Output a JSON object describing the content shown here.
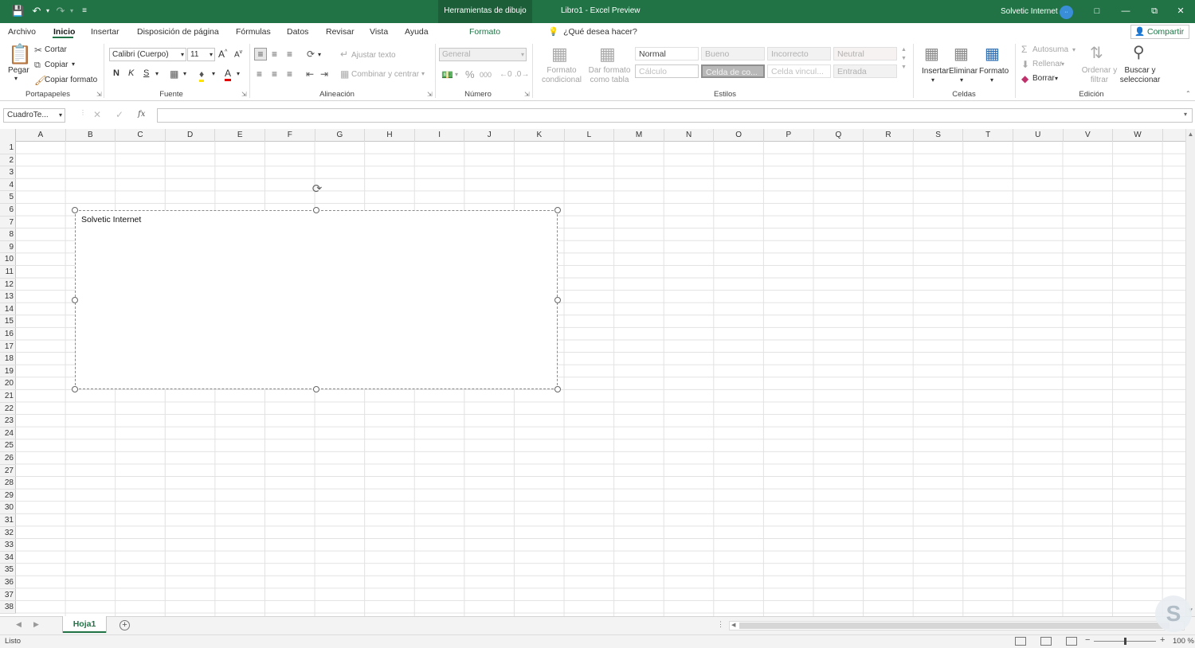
{
  "titlebar": {
    "context_tab": "Herramientas de dibujo",
    "title": "Libro1  -  Excel Preview",
    "user": "Solvetic Internet",
    "avatar_initials": "··"
  },
  "tabs": [
    {
      "label": "Archivo"
    },
    {
      "label": "Inicio"
    },
    {
      "label": "Insertar"
    },
    {
      "label": "Disposición de página"
    },
    {
      "label": "Fórmulas"
    },
    {
      "label": "Datos"
    },
    {
      "label": "Revisar"
    },
    {
      "label": "Vista"
    },
    {
      "label": "Ayuda"
    },
    {
      "label": "Formato"
    }
  ],
  "tell_me": "¿Qué desea hacer?",
  "share": "Compartir",
  "ribbon": {
    "clipboard": {
      "paste": "Pegar",
      "cut": "Cortar",
      "copy": "Copiar",
      "format_painter": "Copiar formato",
      "group": "Portapapeles"
    },
    "font": {
      "name": "Calibri (Cuerpo)",
      "size": "11",
      "bold": "N",
      "italic": "K",
      "underline": "S",
      "group": "Fuente"
    },
    "alignment": {
      "wrap": "Ajustar texto",
      "merge": "Combinar y centrar",
      "group": "Alineación"
    },
    "number": {
      "format": "General",
      "percent": "%",
      "thousands": "000",
      "group": "Número"
    },
    "styles": {
      "conditional": "Formato condicional",
      "as_table": "Dar formato como tabla",
      "cells": [
        "Normal",
        "Bueno",
        "Incorrecto",
        "Neutral",
        "Cálculo",
        "Celda de co...",
        "Celda vincul...",
        "Entrada"
      ],
      "group": "Estilos"
    },
    "cells": {
      "insert": "Insertar",
      "delete": "Eliminar",
      "format": "Formato",
      "group": "Celdas"
    },
    "editing": {
      "autosum": "Autosuma",
      "fill": "Rellenar",
      "clear": "Borrar",
      "sort": "Ordenar y filtrar",
      "find": "Buscar y seleccionar",
      "group": "Edición"
    }
  },
  "formula_bar": {
    "name_box": "CuadroTe...",
    "fx": "fx",
    "value": ""
  },
  "columns": [
    "A",
    "B",
    "C",
    "D",
    "E",
    "F",
    "G",
    "H",
    "I",
    "J",
    "K",
    "L",
    "M",
    "N",
    "O",
    "P",
    "Q",
    "R",
    "S",
    "T",
    "U",
    "V",
    "W"
  ],
  "rows": [
    "1",
    "2",
    "3",
    "4",
    "5",
    "6",
    "7",
    "8",
    "9",
    "10",
    "11",
    "12",
    "13",
    "14",
    "15",
    "16",
    "17",
    "18",
    "19",
    "20",
    "21",
    "22",
    "23",
    "24",
    "25",
    "26",
    "27",
    "28",
    "29",
    "30",
    "31",
    "32",
    "33",
    "34",
    "35",
    "36",
    "37",
    "38"
  ],
  "textbox": {
    "text": "Solvetic Internet"
  },
  "sheets": [
    {
      "name": "Hoja1"
    }
  ],
  "status": {
    "text": "Listo",
    "zoom": "100 %"
  }
}
